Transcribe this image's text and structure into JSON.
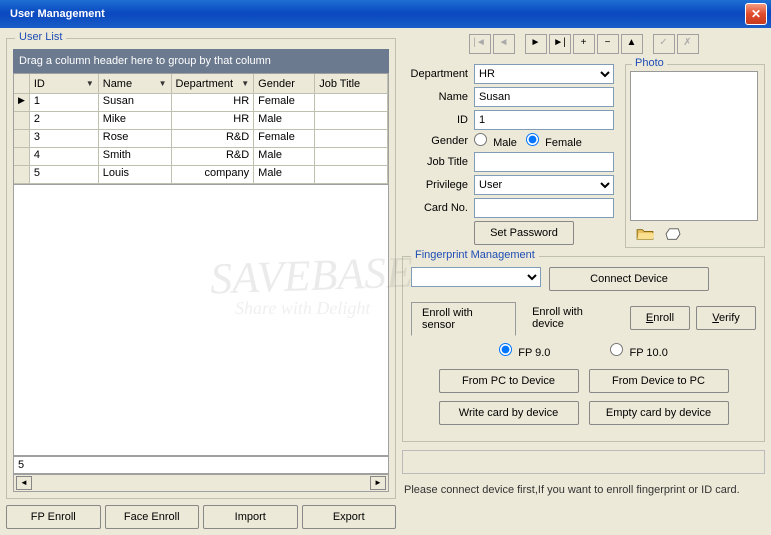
{
  "title": "User Management",
  "userlist": {
    "title": "User List",
    "dragHint": "Drag a column header here to group by that column",
    "cols": {
      "id": "ID",
      "name": "Name",
      "dept": "Department",
      "gender": "Gender",
      "job": "Job Title"
    },
    "rows": [
      {
        "id": "1",
        "name": "Susan",
        "dept": "HR",
        "gender": "Female",
        "job": ""
      },
      {
        "id": "2",
        "name": "Mike",
        "dept": "HR",
        "gender": "Male",
        "job": ""
      },
      {
        "id": "3",
        "name": "Rose",
        "dept": "R&D",
        "gender": "Female",
        "job": ""
      },
      {
        "id": "4",
        "name": "Smith",
        "dept": "R&D",
        "gender": "Male",
        "job": ""
      },
      {
        "id": "5",
        "name": "Louis",
        "dept": "company",
        "gender": "Male",
        "job": ""
      }
    ],
    "filterValue": "5"
  },
  "leftButtons": {
    "fpEnroll": "FP Enroll",
    "faceEnroll": "Face Enroll",
    "import": "Import",
    "export": "Export"
  },
  "form": {
    "labels": {
      "dept": "Department",
      "name": "Name",
      "id": "ID",
      "gender": "Gender",
      "job": "Job Title",
      "priv": "Privilege",
      "card": "Card No.",
      "photo": "Photo"
    },
    "values": {
      "dept": "HR",
      "name": "Susan",
      "id": "1",
      "job": "",
      "priv": "User",
      "card": ""
    },
    "genderOpts": {
      "male": "Male",
      "female": "Female"
    },
    "genderSelected": "female",
    "setPassword": "Set Password"
  },
  "fp": {
    "title": "Fingerprint Management",
    "connect": "Connect Device",
    "tabSensor": "Enroll with sensor",
    "tabDevice": "Enroll with device",
    "enroll": "Enroll",
    "verify": "Verify",
    "fp9": "FP 9.0",
    "fp10": "FP 10.0",
    "pcToDev": "From PC to Device",
    "devToPc": "From Device to PC",
    "writeCard": "Write card by device",
    "emptyCard": "Empty card by device"
  },
  "hint": "Please connect device first,If you want to enroll fingerprint or ID card.",
  "watermark": {
    "main": "SAVEBASE",
    "sub": "Share with Delight"
  }
}
